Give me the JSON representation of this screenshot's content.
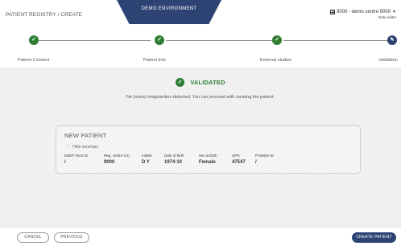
{
  "header": {
    "breadcrumb": "PATIENT REGISTRY / CREATE",
    "banner": "DEMO ENVIRONMENT",
    "centre": "9000 - demo centre 9000",
    "role": "Data editor"
  },
  "stepper": {
    "steps": [
      {
        "label": "Patient Consent",
        "status": "done"
      },
      {
        "label": "Patient Info",
        "status": "done"
      },
      {
        "label": "External studies",
        "status": "done"
      },
      {
        "label": "Validation",
        "status": "current"
      }
    ]
  },
  "validation": {
    "status": "VALIDATED",
    "message": "No (more) irregularities detected. You can proceed with creating the patient."
  },
  "summary": {
    "title": "NEW PATIENT",
    "toggle": "Hide summary",
    "columns": [
      {
        "label": "EBMT short ID",
        "value": "/"
      },
      {
        "label": "Reg. centre CIC",
        "value": "9000"
      },
      {
        "label": "Initials",
        "value": "D Y"
      },
      {
        "label": "Date of birth",
        "value": "1974-10"
      },
      {
        "label": "Sex at birth",
        "value": "Female"
      },
      {
        "label": "UPN",
        "value": "47547"
      },
      {
        "label": "ProMISe ID",
        "value": "/"
      }
    ]
  },
  "footer": {
    "cancel": "CANCEL",
    "previous": "PREVIOUS",
    "create": "CREATE PATIENT"
  },
  "colors": {
    "primary": "#2d4373",
    "success": "#2e7d32",
    "background": "#f0f0f0"
  }
}
